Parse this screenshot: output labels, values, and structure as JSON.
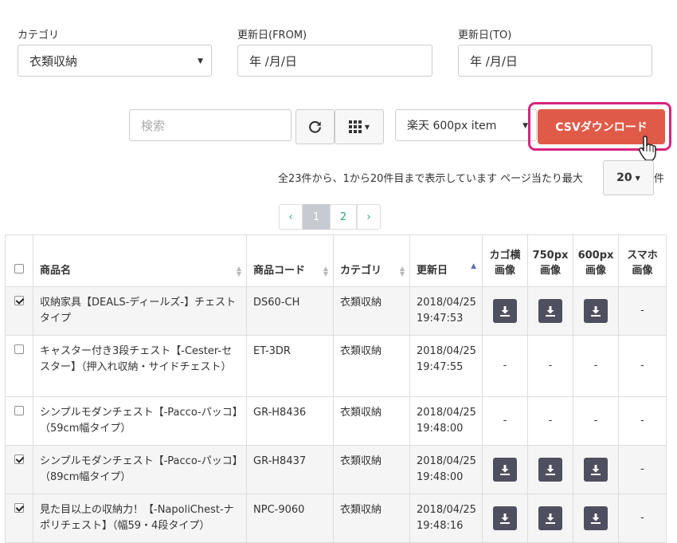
{
  "filters": {
    "category": {
      "label": "カテゴリ",
      "value": "衣類収納"
    },
    "date_from": {
      "label": "更新日(FROM)",
      "placeholder": "年 /月/日"
    },
    "date_to": {
      "label": "更新日(TO)",
      "placeholder": "年 /月/日"
    }
  },
  "toolbar": {
    "search_placeholder": "検索",
    "refresh_icon": "refresh-icon",
    "columns_icon": "grid-icon",
    "image_type": "楽天 600px item",
    "csv_label": "CSVダウンロード"
  },
  "pagination_info": {
    "text": "全23件から、1から20件目まで表示しています ページ当たり最大",
    "per_page": "20",
    "suffix": "件"
  },
  "pager": {
    "prev": "‹",
    "pages": [
      "1",
      "2"
    ],
    "next": "›",
    "active": "1"
  },
  "table": {
    "headers": {
      "name": "商品名",
      "code": "商品コード",
      "category": "カテゴリ",
      "updated": "更新日",
      "cago_line1": "カゴ横",
      "cago_line2": "画像",
      "img750_line1": "750px",
      "img750_line2": "画像",
      "img600_line1": "600px",
      "img600_line2": "画像",
      "sp_line1": "スマホ",
      "sp_line2": "画像"
    },
    "dash": "-",
    "rows": [
      {
        "checked": true,
        "name": "収納家具【DEALS-ディールズ-】チェストタイプ",
        "code": "DS60-CH",
        "category": "衣類収納",
        "date": "2018/04/25",
        "time": "19:47:53",
        "cago": true,
        "img750": true,
        "img600": true,
        "sp": false
      },
      {
        "checked": false,
        "name": "キャスター付き3段チェスト【-Cester-セスター】（押入れ収納・サイドチェスト）",
        "code": "ET-3DR",
        "category": "衣類収納",
        "date": "2018/04/25",
        "time": "19:47:55",
        "cago": false,
        "img750": false,
        "img600": false,
        "sp": false
      },
      {
        "checked": false,
        "name": "シンプルモダンチェスト【-Pacco-パッコ】（59cm幅タイプ）",
        "code": "GR-H8436",
        "category": "衣類収納",
        "date": "2018/04/25",
        "time": "19:48:00",
        "cago": false,
        "img750": false,
        "img600": false,
        "sp": false
      },
      {
        "checked": true,
        "name": "シンプルモダンチェスト【-Pacco-パッコ】（89cm幅タイプ）",
        "code": "GR-H8437",
        "category": "衣類収納",
        "date": "2018/04/25",
        "time": "19:48:00",
        "cago": true,
        "img750": true,
        "img600": true,
        "sp": false
      },
      {
        "checked": true,
        "name": "見た目以上の収納力！【-NapoliChest-ナポリチェスト】（幅59・4段タイプ）",
        "code": "NPC-9060",
        "category": "衣類収納",
        "date": "2018/04/25",
        "time": "19:48:16",
        "cago": true,
        "img750": true,
        "img600": true,
        "sp": false
      }
    ]
  }
}
